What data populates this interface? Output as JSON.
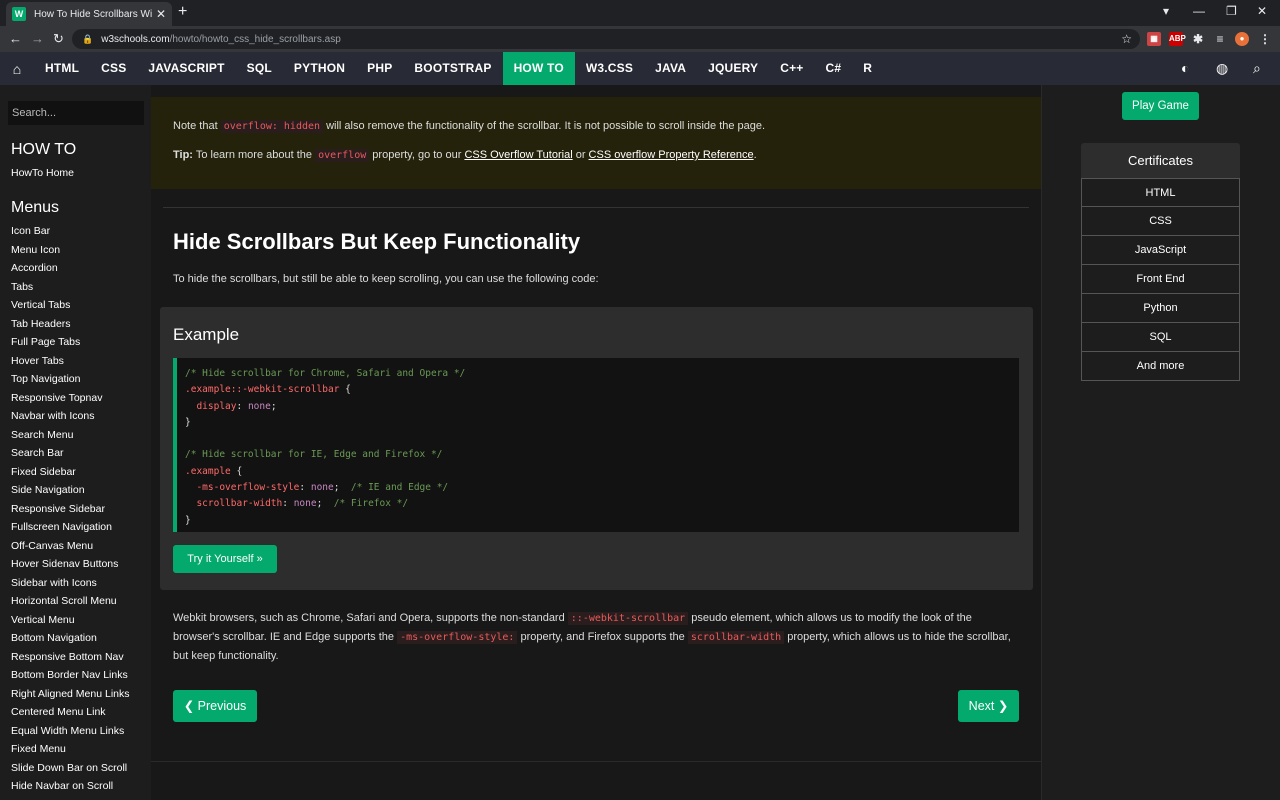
{
  "browser": {
    "tab_title": "How To Hide Scrollbars With CSS",
    "tab_favicon": "W",
    "url_host": "w3schools.com",
    "url_path": "/howto/howto_css_hide_scrollbars.asp",
    "abp_label": "ABP"
  },
  "topnav": {
    "items": [
      {
        "label": "HTML"
      },
      {
        "label": "CSS"
      },
      {
        "label": "JAVASCRIPT"
      },
      {
        "label": "SQL"
      },
      {
        "label": "PYTHON"
      },
      {
        "label": "PHP"
      },
      {
        "label": "BOOTSTRAP"
      },
      {
        "label": "HOW TO",
        "active": true
      },
      {
        "label": "W3.CSS"
      },
      {
        "label": "JAVA"
      },
      {
        "label": "JQUERY"
      },
      {
        "label": "C++"
      },
      {
        "label": "C#"
      },
      {
        "label": "R"
      }
    ],
    "accent": "#04aa6d"
  },
  "sidebar": {
    "search_placeholder": "Search...",
    "howto_heading": "HOW TO",
    "howto_home": "HowTo Home",
    "menus_heading": "Menus",
    "links": [
      "Icon Bar",
      "Menu Icon",
      "Accordion",
      "Tabs",
      "Vertical Tabs",
      "Tab Headers",
      "Full Page Tabs",
      "Hover Tabs",
      "Top Navigation",
      "Responsive Topnav",
      "Navbar with Icons",
      "Search Menu",
      "Search Bar",
      "Fixed Sidebar",
      "Side Navigation",
      "Responsive Sidebar",
      "Fullscreen Navigation",
      "Off-Canvas Menu",
      "Hover Sidenav Buttons",
      "Sidebar with Icons",
      "Horizontal Scroll Menu",
      "Vertical Menu",
      "Bottom Navigation",
      "Responsive Bottom Nav",
      "Bottom Border Nav Links",
      "Right Aligned Menu Links",
      "Centered Menu Link",
      "Equal Width Menu Links",
      "Fixed Menu",
      "Slide Down Bar on Scroll",
      "Hide Navbar on Scroll"
    ]
  },
  "main": {
    "note_pre": "Note that ",
    "note_code": "overflow: hidden",
    "note_post": " will also remove the functionality of the scrollbar. It is not possible to scroll inside the page.",
    "tip_label": "Tip:",
    "tip_pre": " To learn more about the ",
    "tip_code": "overflow",
    "tip_mid": " property, go to our ",
    "tip_link1": "CSS Overflow Tutorial",
    "tip_or": " or ",
    "tip_link2": "CSS overflow Property Reference",
    "tip_end": ".",
    "heading": "Hide Scrollbars But Keep Functionality",
    "intro": "To hide the scrollbars, but still be able to keep scrolling, you can use the following code:",
    "example_title": "Example",
    "code": {
      "c1": "/* Hide scrollbar for Chrome, Safari and Opera */",
      "s1": ".example::-webkit-scrollbar",
      "p1": "display",
      "v1": "none",
      "c2": "/* Hide scrollbar for IE, Edge and Firefox */",
      "s2": ".example",
      "p2": "-ms-overflow-style",
      "v2": "none",
      "c3": "/* IE and Edge */",
      "p3": "scrollbar-width",
      "v3": "none",
      "c4": "/* Firefox */"
    },
    "try_button": "Try it Yourself »",
    "para_1": "Webkit browsers, such as Chrome, Safari and Opera, supports the non-standard ",
    "para_code1": "::-webkit-scrollbar",
    "para_2": " pseudo element, which allows us to modify the look of the browser's scrollbar. IE and Edge supports the ",
    "para_code2": "-ms-overflow-style:",
    "para_3": " property, and Firefox supports the ",
    "para_code3": "scrollbar-width",
    "para_4": " property, which allows us to hide the scrollbar, but keep functionality.",
    "prev_button": "❮ Previous",
    "next_button": "Next ❯"
  },
  "right": {
    "play_game": "Play Game",
    "cert_heading": "Certificates",
    "certs": [
      "HTML",
      "CSS",
      "JavaScript",
      "Front End",
      "Python",
      "SQL",
      "And more"
    ]
  }
}
